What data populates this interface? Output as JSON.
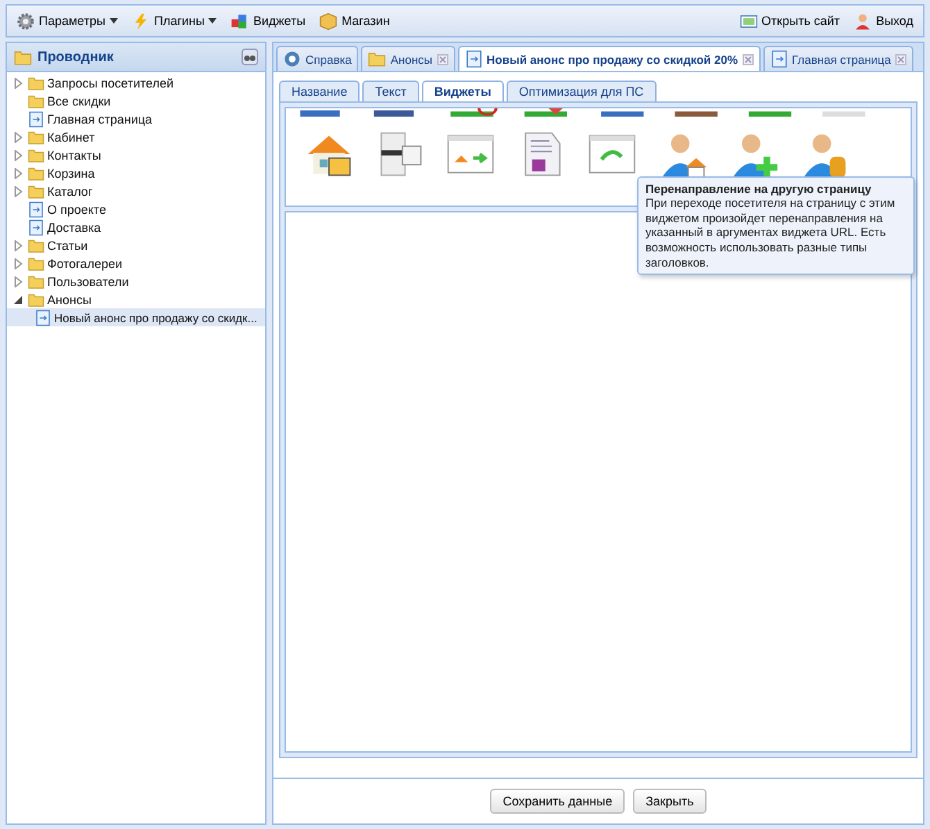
{
  "toolbar": {
    "left": [
      {
        "label": "Параметры",
        "dropdown": true
      },
      {
        "label": "Плагины",
        "dropdown": true
      },
      {
        "label": "Виджеты",
        "dropdown": false
      },
      {
        "label": "Магазин",
        "dropdown": false
      }
    ],
    "right": [
      {
        "label": "Открыть сайт"
      },
      {
        "label": "Выход"
      }
    ]
  },
  "explorer": {
    "title": "Проводник",
    "items": [
      {
        "label": "Запросы посетителей",
        "kind": "folder",
        "expandable": true,
        "expanded": false,
        "selected": false
      },
      {
        "label": "Все скидки",
        "kind": "folder",
        "expandable": false,
        "selected": false
      },
      {
        "label": "Главная страница",
        "kind": "page",
        "expandable": false,
        "selected": false
      },
      {
        "label": "Кабинет",
        "kind": "folder",
        "expandable": true,
        "expanded": false,
        "selected": false
      },
      {
        "label": "Контакты",
        "kind": "folder",
        "expandable": true,
        "expanded": false,
        "selected": false
      },
      {
        "label": "Корзина",
        "kind": "folder",
        "expandable": true,
        "expanded": false,
        "selected": false
      },
      {
        "label": "Каталог",
        "kind": "folder",
        "expandable": true,
        "expanded": false,
        "selected": false
      },
      {
        "label": "О проекте",
        "kind": "page",
        "expandable": false,
        "selected": false
      },
      {
        "label": "Доставка",
        "kind": "page",
        "expandable": false,
        "selected": false
      },
      {
        "label": "Статьи",
        "kind": "folder",
        "expandable": true,
        "expanded": false,
        "selected": false
      },
      {
        "label": "Фотогалереи",
        "kind": "folder",
        "expandable": true,
        "expanded": false,
        "selected": false
      },
      {
        "label": "Пользователи",
        "kind": "folder",
        "expandable": true,
        "expanded": false,
        "selected": false
      },
      {
        "label": "Анонсы",
        "kind": "folder",
        "expandable": true,
        "expanded": true,
        "selected": false,
        "children": [
          {
            "label": "Новый анонс про продажу со скидк...",
            "kind": "page",
            "selected": true
          }
        ]
      }
    ]
  },
  "tabs": [
    {
      "label": "Справка",
      "closable": false,
      "selected": false
    },
    {
      "label": "Анонсы",
      "closable": true,
      "selected": false
    },
    {
      "label": "Новый анонс про продажу со скидкой 20%",
      "closable": true,
      "selected": true
    },
    {
      "label": "Главная страница",
      "closable": true,
      "selected": false
    }
  ],
  "subtabs": [
    {
      "label": "Название",
      "selected": false
    },
    {
      "label": "Текст",
      "selected": false
    },
    {
      "label": "Виджеты",
      "selected": true
    },
    {
      "label": "Оптимизация для ПС",
      "selected": false
    }
  ],
  "widgets": [
    {
      "kind": "house"
    },
    {
      "kind": "slider"
    },
    {
      "kind": "window-redirect"
    },
    {
      "kind": "newspaper"
    },
    {
      "kind": "window-arrow"
    },
    {
      "kind": "user-house"
    },
    {
      "kind": "user-plus"
    },
    {
      "kind": "user-coins"
    }
  ],
  "tooltip": {
    "title": "Перенаправление на другую страницу",
    "text": "При переходе посетителя на страницу с этим виджетом произойдет перенаправления на указанный в аргументах виджета URL. Есть возможность использовать разные типы заголовков."
  },
  "buttons": [
    "Сохранить данные",
    "Закрыть"
  ]
}
